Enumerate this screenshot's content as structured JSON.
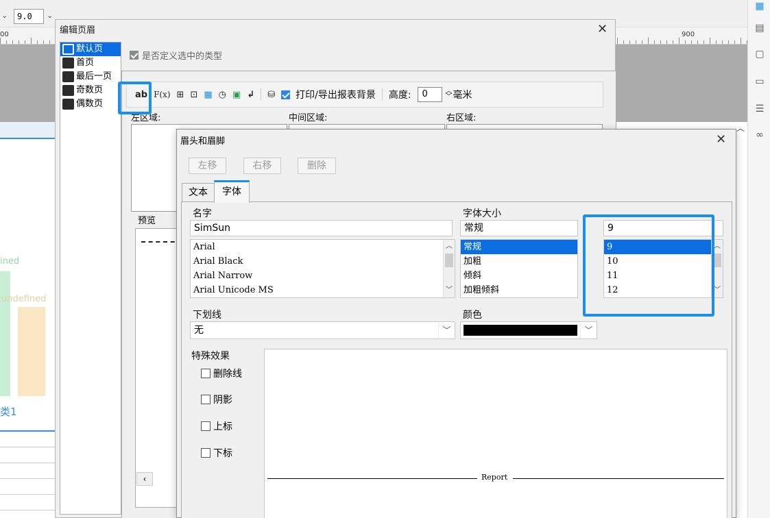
{
  "app": {
    "font_size": "9.0",
    "ruler_left": "00",
    "ruler_right": "900",
    "canvas_text_1": "ined",
    "canvas_text_2": "undefined",
    "canvas_text_3": "类1"
  },
  "edit_dialog": {
    "title": "编辑页眉",
    "page_types": [
      "默认页",
      "首页",
      "最后一页",
      "奇数页",
      "偶数页"
    ],
    "selected_page": "默认页",
    "custom_type_label": "是否定义选中的类型",
    "toolbar": {
      "ab": "ab",
      "fx": "F(x)",
      "print_bg_label": "打印/导出报表背景",
      "height_label": "高度:",
      "height_value": "0",
      "height_unit": "毫米"
    },
    "regions": {
      "left": "左区域:",
      "middle": "中间区域:",
      "right": "右区域:"
    },
    "preview_label": "预览"
  },
  "hf_dialog": {
    "title": "眉头和眉脚",
    "buttons": {
      "move_left": "左移",
      "move_right": "右移",
      "delete": "删除"
    },
    "tabs": [
      "文本",
      "字体"
    ],
    "active_tab": "字体",
    "name_label": "名字",
    "font_name": "SimSun",
    "fonts": [
      "Arial",
      "Arial Black",
      "Arial Narrow",
      "Arial Unicode MS"
    ],
    "style_size_label": "字体大小",
    "style_value": "常规",
    "styles": [
      "常规",
      "加粗",
      "倾斜",
      "加粗倾斜"
    ],
    "size_value": "9",
    "sizes": [
      "9",
      "10",
      "11",
      "12"
    ],
    "underline_label": "下划线",
    "underline_value": "无",
    "color_label": "颜色",
    "color_value": "#000000",
    "effects_label": "特殊效果",
    "effects": [
      "删除线",
      "阴影",
      "上标",
      "下标"
    ],
    "preview_text": "Report"
  },
  "colors": {
    "accent": "#1b8fec",
    "selection": "#0a6ee0"
  }
}
